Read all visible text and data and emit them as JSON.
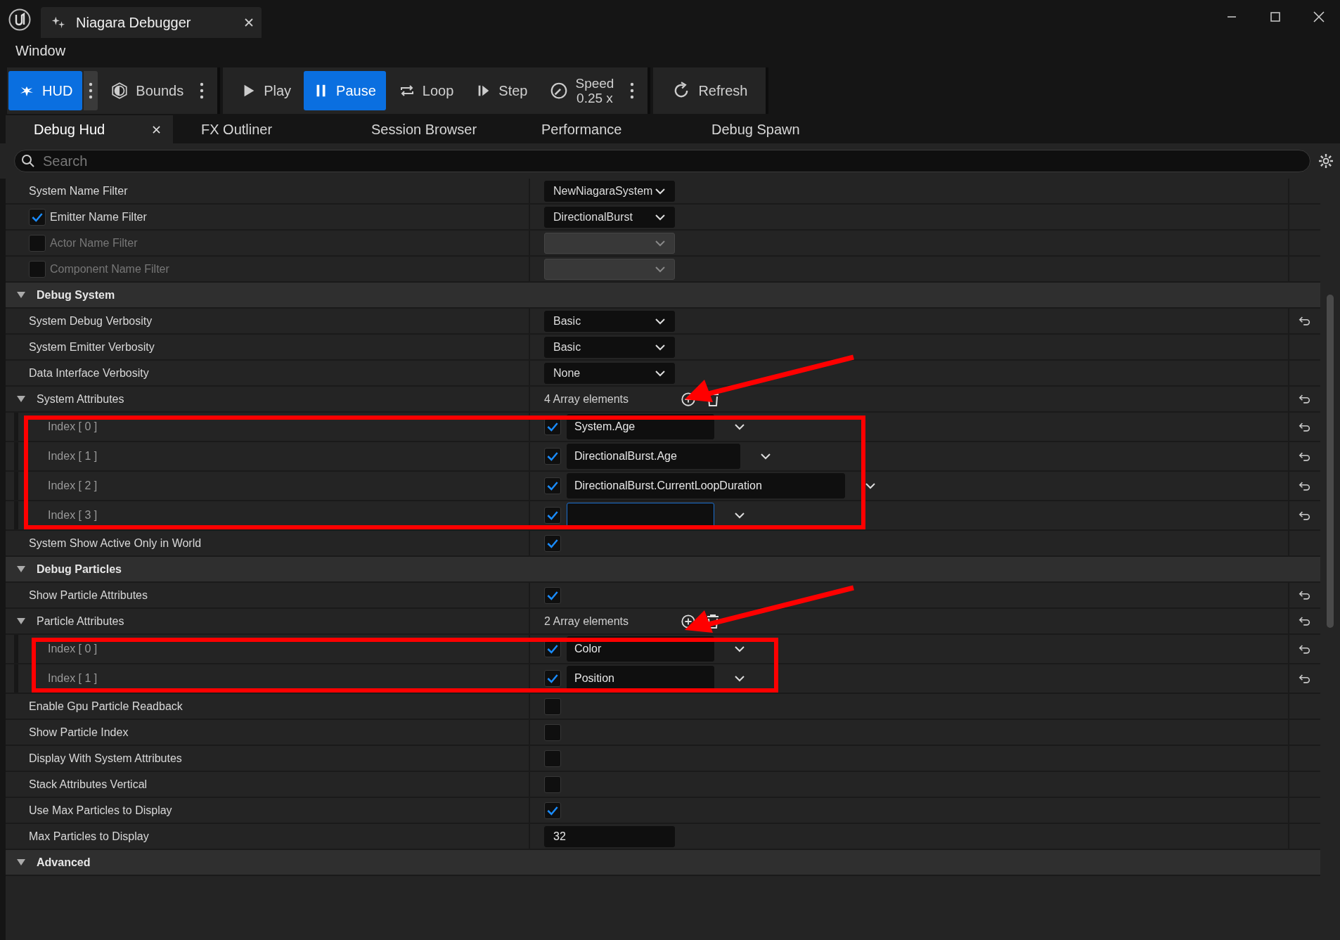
{
  "window": {
    "tab_title": "Niagara Debugger"
  },
  "menu": [
    "Window"
  ],
  "toolbar_groups": [
    [
      {
        "label": "HUD",
        "selected": true,
        "menu": true
      },
      {
        "label": "Bounds",
        "selected": false,
        "menu": true
      }
    ],
    [
      {
        "label": "Play",
        "selected": false,
        "menu": false
      },
      {
        "label": "Pause",
        "selected": true,
        "menu": false
      },
      {
        "label": "Loop",
        "selected": false,
        "menu": false
      },
      {
        "label": "Step",
        "selected": false,
        "menu": false
      },
      {
        "label": "Speed",
        "value": "0.25 x",
        "selected": false,
        "menu": true
      }
    ],
    [
      {
        "label": "Refresh",
        "selected": false,
        "menu": false
      }
    ]
  ],
  "tabs": [
    {
      "label": "Debug Hud",
      "selected": true,
      "closable": true
    },
    {
      "label": "FX Outliner",
      "selected": false,
      "closable": false
    },
    {
      "label": "Session Browser",
      "selected": false,
      "closable": false
    },
    {
      "label": "Performance",
      "selected": false,
      "closable": false
    },
    {
      "label": "Debug Spawn",
      "selected": false,
      "closable": false
    }
  ],
  "search": {
    "placeholder": "Search"
  },
  "rows": [
    {
      "kind": "property",
      "label": "System Name Filter",
      "disabled": false,
      "reset": false,
      "value": {
        "kind": "dropdown",
        "text": "NewNiagaraSystem",
        "disabled": false
      }
    },
    {
      "kind": "property",
      "label": "Emitter Name Filter",
      "edit_checked": true,
      "disabled": false,
      "reset": false,
      "value": {
        "kind": "dropdown",
        "text": "DirectionalBurst",
        "disabled": false
      }
    },
    {
      "kind": "property",
      "label": "Actor Name Filter",
      "edit_checked": false,
      "disabled": true,
      "reset": false,
      "value": {
        "kind": "dropdown",
        "disabled": true
      }
    },
    {
      "kind": "property",
      "label": "Component Name Filter",
      "edit_checked": false,
      "disabled": true,
      "reset": false,
      "value": {
        "kind": "dropdown",
        "disabled": true
      }
    },
    {
      "kind": "section",
      "label": "Debug System",
      "expanded": true
    },
    {
      "kind": "property",
      "label": "System Debug Verbosity",
      "disabled": false,
      "reset": true,
      "value": {
        "kind": "dropdown",
        "text": "Basic",
        "disabled": false
      }
    },
    {
      "kind": "property",
      "label": "System Emitter Verbosity",
      "disabled": false,
      "reset": false,
      "value": {
        "kind": "dropdown",
        "text": "Basic",
        "disabled": false
      }
    },
    {
      "kind": "property",
      "label": "Data Interface Verbosity",
      "disabled": false,
      "reset": false,
      "value": {
        "kind": "dropdown",
        "text": "None",
        "disabled": false
      }
    },
    {
      "kind": "array",
      "label": "System Attributes",
      "expanded": true,
      "count": "4 Array elements",
      "reset": true,
      "highlighted": true,
      "elements": [
        {
          "label": "Index [ 0 ]",
          "checked": true,
          "value": "System.Age",
          "focused": false,
          "reset": true
        },
        {
          "label": "Index [ 1 ]",
          "checked": true,
          "value": "DirectionalBurst.Age",
          "focused": false,
          "reset": true
        },
        {
          "label": "Index [ 2 ]",
          "checked": true,
          "value": "DirectionalBurst.CurrentLoopDuration",
          "focused": false,
          "reset": true
        },
        {
          "label": "Index [ 3 ]",
          "checked": true,
          "focused": true,
          "reset": true
        }
      ]
    },
    {
      "kind": "property",
      "label": "System Show Active Only in World",
      "disabled": false,
      "reset": false,
      "value": {
        "kind": "checkbox",
        "checked": true
      }
    },
    {
      "kind": "section",
      "label": "Debug Particles",
      "expanded": true
    },
    {
      "kind": "property",
      "label": "Show Particle Attributes",
      "disabled": false,
      "reset": true,
      "value": {
        "kind": "checkbox",
        "checked": true
      }
    },
    {
      "kind": "array",
      "label": "Particle Attributes",
      "expanded": true,
      "count": "2 Array elements",
      "reset": true,
      "highlighted": true,
      "elements": [
        {
          "label": "Index [ 0 ]",
          "checked": true,
          "value": "Color",
          "focused": false,
          "reset": true
        },
        {
          "label": "Index [ 1 ]",
          "checked": true,
          "value": "Position",
          "focused": false,
          "reset": true
        }
      ]
    },
    {
      "kind": "property",
      "label": "Enable Gpu Particle Readback",
      "disabled": false,
      "reset": false,
      "value": {
        "kind": "checkbox",
        "checked": false
      }
    },
    {
      "kind": "property",
      "label": "Show Particle Index",
      "disabled": false,
      "reset": false,
      "value": {
        "kind": "checkbox",
        "checked": false
      }
    },
    {
      "kind": "property",
      "label": "Display With System Attributes",
      "disabled": false,
      "reset": false,
      "value": {
        "kind": "checkbox",
        "checked": false
      }
    },
    {
      "kind": "property",
      "label": "Stack Attributes Vertical",
      "disabled": false,
      "reset": false,
      "value": {
        "kind": "checkbox",
        "checked": false
      }
    },
    {
      "kind": "property",
      "label": "Use Max Particles to Display",
      "disabled": false,
      "reset": false,
      "value": {
        "kind": "checkbox",
        "checked": true
      }
    },
    {
      "kind": "property",
      "label": "Max Particles to Display",
      "disabled": false,
      "reset": false,
      "value": {
        "kind": "number",
        "text": "32"
      }
    },
    {
      "kind": "section",
      "label": "Advanced",
      "expanded": true
    }
  ]
}
